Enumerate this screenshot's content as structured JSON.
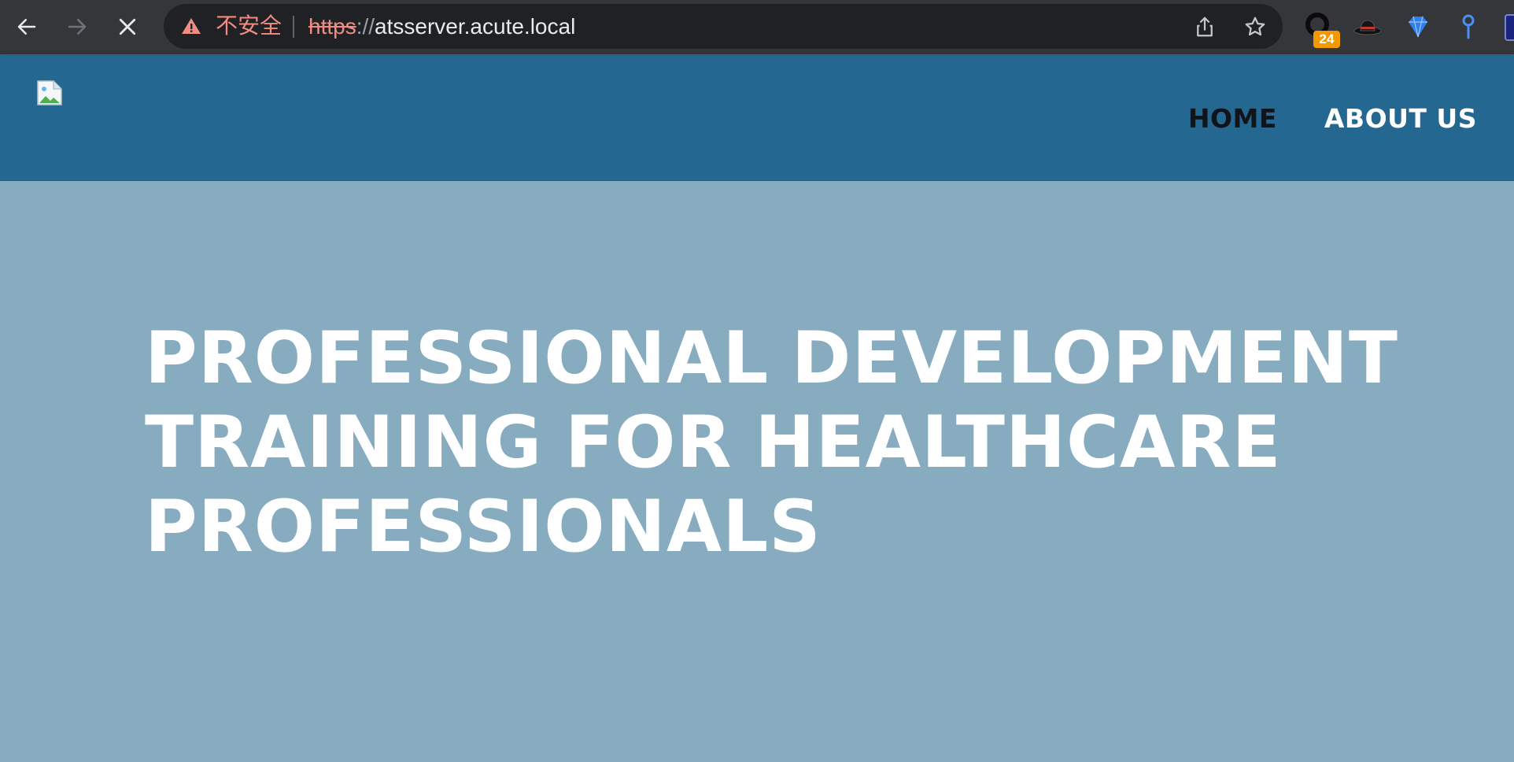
{
  "browser": {
    "security_label": "不安全",
    "url_scheme": "https",
    "url_separator": "://",
    "url_host": "atsserver.acute.local",
    "extension_badge": "24",
    "icons": {
      "back": "arrow-left-icon",
      "forward": "arrow-right-icon",
      "stop": "close-icon",
      "warning": "warning-triangle-icon",
      "share": "share-icon",
      "bookmark": "star-icon"
    }
  },
  "site": {
    "nav": [
      {
        "label": "HOME",
        "active": true
      },
      {
        "label": "ABOUT US",
        "active": false
      }
    ]
  },
  "hero": {
    "title": "PROFESSIONAL DEVELOPMENT TRAINING FOR HEALTHCARE PROFESSIONALS"
  },
  "colors": {
    "chrome": "#35363a",
    "omnibox": "#202124",
    "header": "#246791",
    "hero": "#87acc0",
    "insecure": "#f28b82",
    "badge": "#f29900"
  }
}
